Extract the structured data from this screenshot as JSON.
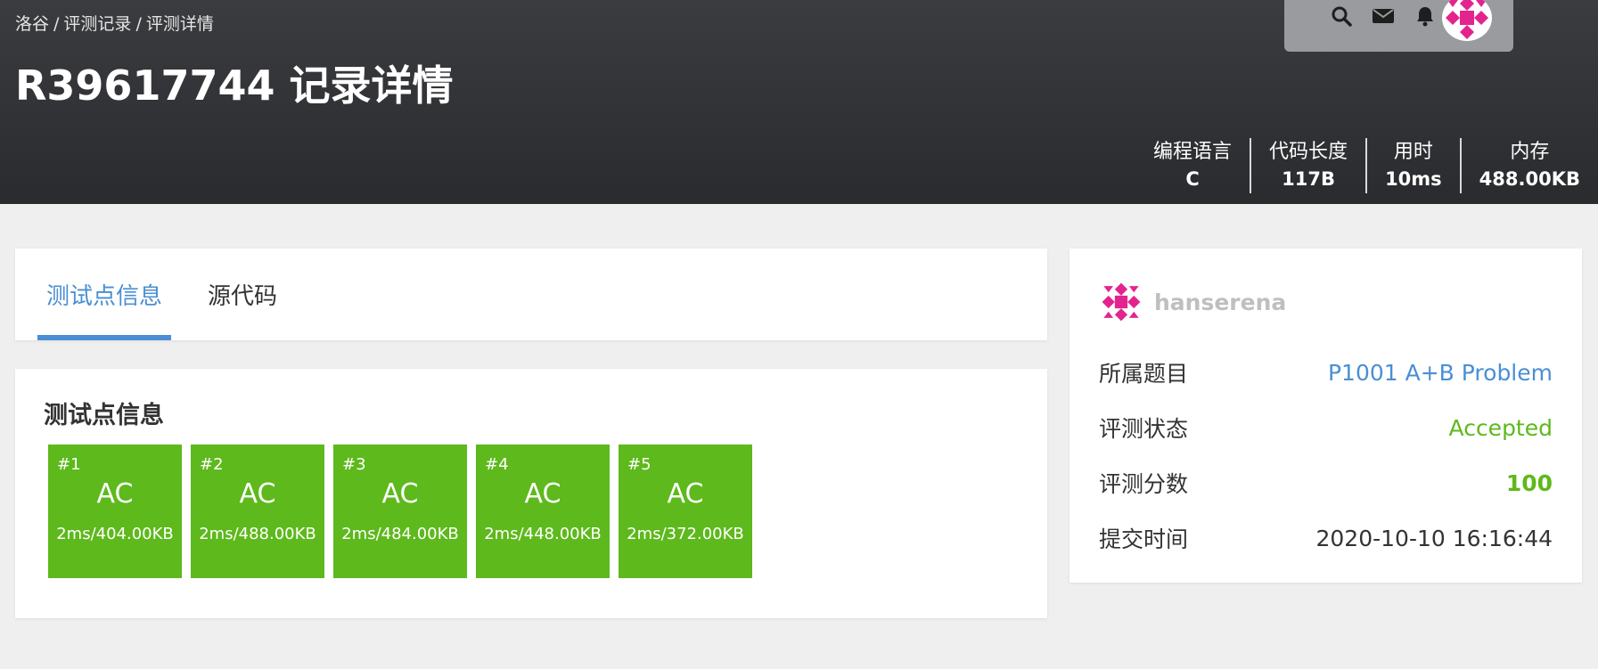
{
  "breadcrumb": [
    "洛谷",
    "评测记录",
    "评测详情"
  ],
  "breadcrumb_sep": "/",
  "page_title": "R39617744 记录详情",
  "topbar": {
    "icons": [
      "search-icon",
      "mail-icon",
      "bell-icon"
    ],
    "avatar_color": "#e3248f"
  },
  "stats": [
    {
      "label": "编程语言",
      "value": "C"
    },
    {
      "label": "代码长度",
      "value": "117B"
    },
    {
      "label": "用时",
      "value": "10ms"
    },
    {
      "label": "内存",
      "value": "488.00KB"
    }
  ],
  "tabs": [
    {
      "label": "测试点信息",
      "active": true
    },
    {
      "label": "源代码",
      "active": false
    }
  ],
  "tests": {
    "title": "测试点信息",
    "items": [
      {
        "num": "#1",
        "status": "AC",
        "detail": "2ms/404.00KB"
      },
      {
        "num": "#2",
        "status": "AC",
        "detail": "2ms/488.00KB"
      },
      {
        "num": "#3",
        "status": "AC",
        "detail": "2ms/484.00KB"
      },
      {
        "num": "#4",
        "status": "AC",
        "detail": "2ms/448.00KB"
      },
      {
        "num": "#5",
        "status": "AC",
        "detail": "2ms/372.00KB"
      }
    ]
  },
  "info": {
    "username": "hanserena",
    "rows": [
      {
        "label": "所属题目",
        "value": "P1001 A+B Problem"
      },
      {
        "label": "评测状态",
        "value": "Accepted"
      },
      {
        "label": "评测分数",
        "value": "100"
      },
      {
        "label": "提交时间",
        "value": "2020-10-10 16:16:44"
      }
    ]
  },
  "colors": {
    "accent": "#4a8fd3",
    "accepted": "#5eb91c",
    "header_bg": "#2e2f32",
    "avatar": "#e3248f"
  }
}
